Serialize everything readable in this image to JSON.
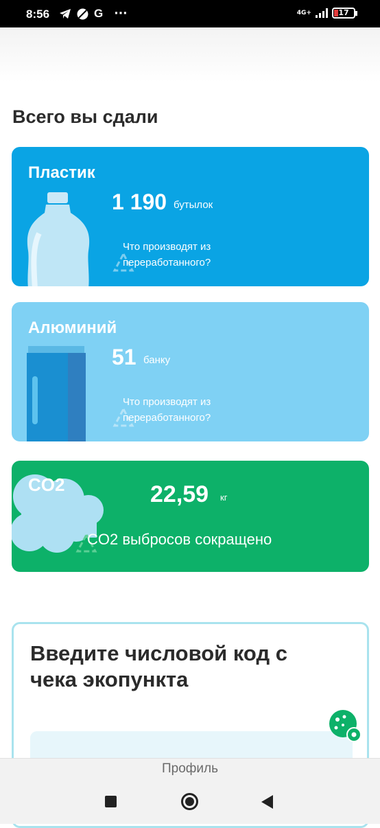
{
  "status_bar": {
    "time": "8:56",
    "network": "4G+",
    "battery": "17"
  },
  "section_title": "Всего вы сдали",
  "cards": {
    "plastic": {
      "title": "Пластик",
      "count": "1 190",
      "unit": "бутылок",
      "link": "Что производят из переработанного?",
      "color": "#0aa4e4"
    },
    "aluminum": {
      "title": "Алюминий",
      "count": "51",
      "unit": "банку",
      "link": "Что производят из переработанного?",
      "color": "#7fd1f4"
    },
    "co2": {
      "title": "CO2",
      "count": "22,59",
      "unit": "кг",
      "description": "CO2 выбросов сокращено",
      "color": "#0db169"
    }
  },
  "code_entry": {
    "heading": "Введите числовой код с чека экопункта"
  },
  "tab_bar": {
    "label": "Профиль"
  }
}
